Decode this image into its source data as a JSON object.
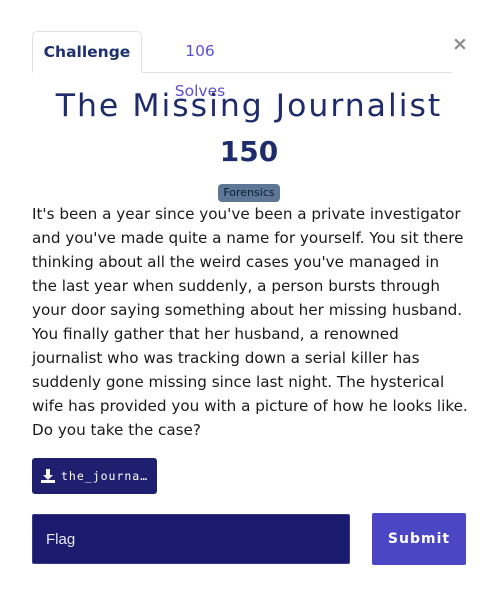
{
  "modal": {
    "close_label": "×"
  },
  "tabs": [
    {
      "label": "Challenge",
      "active": true
    },
    {
      "label": "106 Solves",
      "active": false
    }
  ],
  "challenge": {
    "name": "The Missing Journalist",
    "value": "150",
    "category": "Forensics",
    "description": "It's been a year since you've been a private investigator and you've made quite a name for yourself. You sit there thinking about all the weird cases you've managed in the last year when suddenly, a person bursts through your door saying something about her missing husband. You finally gather that her husband, a renowned journalist who was tracking down a serial killer has suddenly gone missing since last night. The hysterical wife has provided you with a picture of how he looks like. Do you take the case?",
    "file": {
      "name": "the_journalist",
      "icon": "download-icon"
    }
  },
  "form": {
    "flag_placeholder": "Flag",
    "flag_value": "",
    "submit_label": "Submit"
  },
  "colors": {
    "title": "#1e2c6b",
    "tab_inactive": "#5b4fd0",
    "file_button": "#1e1f6e",
    "flag_input": "#1a1a6e",
    "submit_button": "#4b46c4",
    "badge": "#5e7796"
  }
}
